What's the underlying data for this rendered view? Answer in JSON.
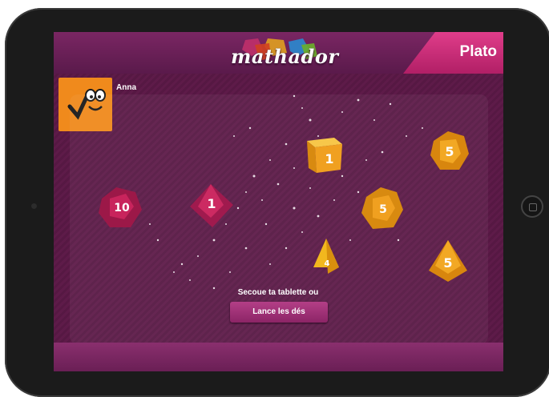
{
  "app": {
    "logo_text": "mathador",
    "mode_label": "Plato"
  },
  "player": {
    "name": "Anna",
    "avatar_icon": "mascot-face-icon"
  },
  "dice": [
    {
      "name": "d12-die",
      "color": "#b01c52",
      "label": "10"
    },
    {
      "name": "d8-die",
      "color": "#b01c52",
      "label": "1"
    },
    {
      "name": "d6-die",
      "color": "#f0a020",
      "label": "1"
    },
    {
      "name": "d4-die",
      "color": "#f2b81e",
      "label": "4"
    },
    {
      "name": "d12-die",
      "color": "#f0a020",
      "label": "5"
    },
    {
      "name": "d12-die",
      "color": "#f0a020",
      "label": "5"
    },
    {
      "name": "d8-die",
      "color": "#f0a020",
      "label": "5"
    }
  ],
  "instructions": {
    "shake_text": "Secoue ta tablette ou",
    "roll_button": "Lance les dés"
  },
  "colors": {
    "accent_pink": "#d8327c",
    "background": "#5e1b49",
    "button": "#a2347a"
  }
}
